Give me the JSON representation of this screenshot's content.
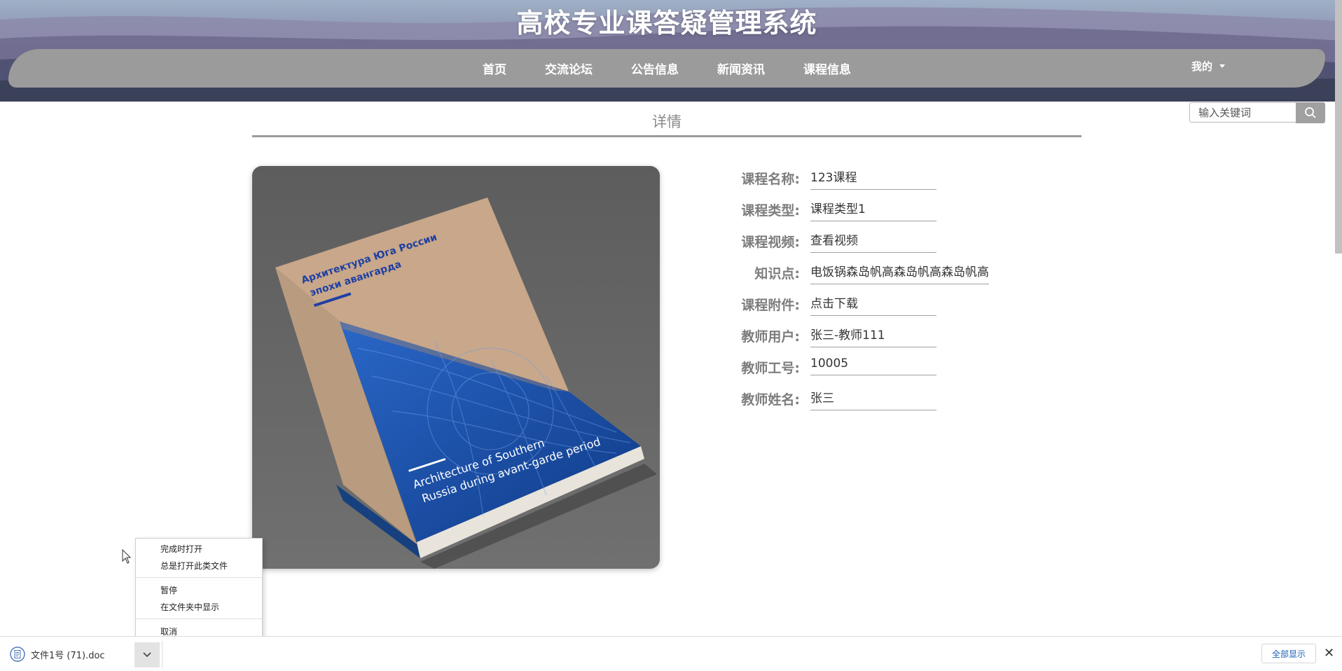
{
  "site": {
    "title": "高校专业课答疑管理系统"
  },
  "nav": {
    "items": [
      "首页",
      "交流论坛",
      "公告信息",
      "新闻资讯",
      "课程信息"
    ],
    "user_menu": "我的"
  },
  "search": {
    "placeholder": "输入关键词"
  },
  "detail": {
    "title": "详情",
    "image": {
      "cover_title_ru_1": "Архитектура Юга России",
      "cover_title_ru_2": "эпохи авангарда",
      "cover_title_en_1": "Architecture of Southern",
      "cover_title_en_2": "Russia during avant-garde period"
    },
    "fields": [
      {
        "label": "课程名称:",
        "value": "123课程"
      },
      {
        "label": "课程类型:",
        "value": "课程类型1"
      },
      {
        "label": "课程视频:",
        "value": "查看视频"
      },
      {
        "label": "知识点:",
        "value": "电饭锅森岛帆高森岛帆高森岛帆高"
      },
      {
        "label": "课程附件:",
        "value": "点击下载"
      },
      {
        "label": "教师用户:",
        "value": "张三-教师111"
      },
      {
        "label": "教师工号:",
        "value": "10005"
      },
      {
        "label": "教师姓名:",
        "value": "张三"
      }
    ]
  },
  "context_menu": {
    "items": [
      "完成时打开",
      "总是打开此类文件",
      "暂停",
      "在文件夹中显示",
      "取消"
    ]
  },
  "download_bar": {
    "filename": "文件1号 (71).doc",
    "show_all": "全部显示",
    "close": "✕"
  },
  "colors": {
    "navbar": "#9b9b9b",
    "search_button": "#a0a0a0",
    "label": "#7d7d7d",
    "image_bg": "#686868"
  }
}
